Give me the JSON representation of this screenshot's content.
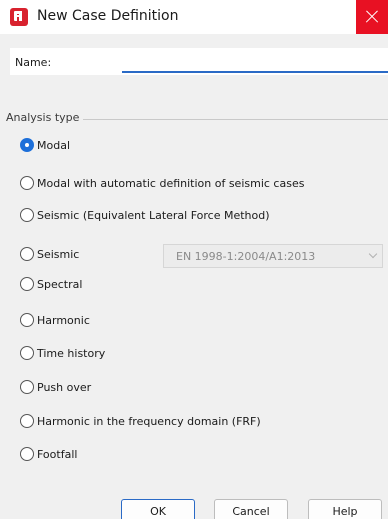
{
  "window": {
    "title": "New Case Definition",
    "app_icon": "robot-app-icon",
    "close_icon": "close-icon",
    "close_color": "#e81123"
  },
  "name_field": {
    "label": "Name:",
    "value": ""
  },
  "analysis_type": {
    "group_label": "Analysis type",
    "options": [
      {
        "label": "Modal",
        "checked": true
      },
      {
        "label": "Modal with automatic definition of seismic cases",
        "checked": false
      },
      {
        "label": "Seismic (Equivalent Lateral Force Method)",
        "checked": false
      },
      {
        "label": "Seismic",
        "checked": false
      },
      {
        "label": "Spectral",
        "checked": false
      },
      {
        "label": "Harmonic",
        "checked": false
      },
      {
        "label": "Time history",
        "checked": false
      },
      {
        "label": "Push over",
        "checked": false
      },
      {
        "label": "Harmonic in the frequency domain (FRF)",
        "checked": false
      },
      {
        "label": "Footfall",
        "checked": false
      }
    ],
    "seismic_code": {
      "value": "EN 1998-1:2004/A1:2013",
      "enabled": false
    }
  },
  "buttons": {
    "ok": "OK",
    "cancel": "Cancel",
    "help": "Help"
  },
  "colors": {
    "accent": "#1d6fd9",
    "input_underline": "#2a6ac6"
  }
}
